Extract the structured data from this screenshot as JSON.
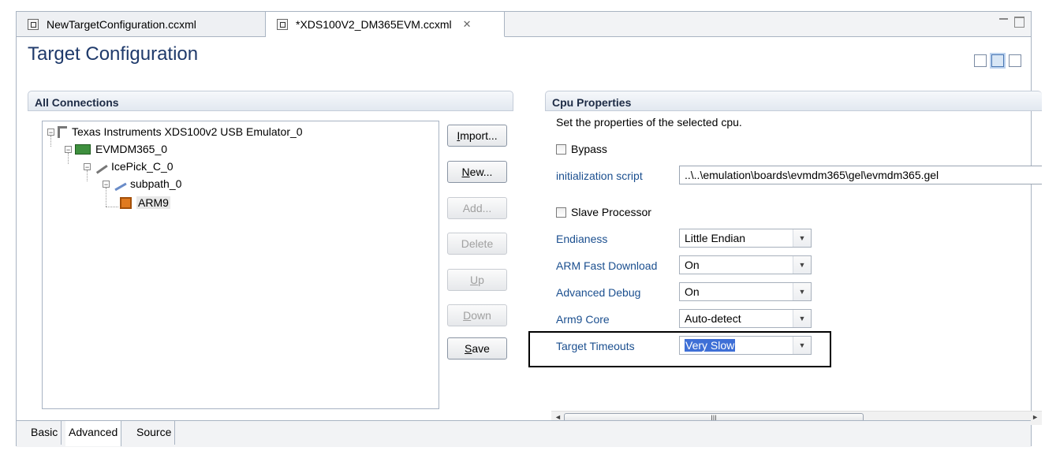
{
  "editor_tabs": [
    {
      "label": "NewTargetConfiguration.ccxml"
    },
    {
      "label": "*XDS100V2_DM365EVM.ccxml",
      "close": "✕"
    }
  ],
  "form_title": "Target Configuration",
  "connections": {
    "title": "All Connections",
    "tree": [
      {
        "label": "Texas Instruments XDS100v2 USB Emulator_0",
        "toggle": "−",
        "icon": "emulator-icon"
      },
      {
        "label": "EVMDM365_0",
        "toggle": "−",
        "icon": "board-icon"
      },
      {
        "label": "IcePick_C_0",
        "toggle": "−",
        "icon": "icepick-icon"
      },
      {
        "label": "subpath_0",
        "toggle": "−",
        "icon": "subpath-icon"
      },
      {
        "label": "ARM9",
        "icon": "cpu-icon"
      }
    ],
    "buttons": {
      "import": {
        "mn": "I",
        "rest": "mport..."
      },
      "new": {
        "mn": "N",
        "rest": "ew..."
      },
      "add": "Add...",
      "delete": "Delete",
      "up": {
        "mn": "U",
        "rest": "p"
      },
      "down": {
        "mn": "D",
        "rest": "own"
      },
      "save": {
        "mn": "S",
        "rest": "ave"
      }
    }
  },
  "cpu_properties": {
    "title": "Cpu Properties",
    "description": "Set the properties of the selected cpu.",
    "bypass_label": "Bypass",
    "init_script_label": "initialization script",
    "init_script_value": "..\\..\\emulation\\boards\\evmdm365\\gel\\evmdm365.gel",
    "slave_label": "Slave Processor",
    "endianess": {
      "label": "Endianess",
      "value": "Little Endian"
    },
    "arm_fast_download": {
      "label": "ARM Fast Download",
      "value": "On"
    },
    "advanced_debug": {
      "label": "Advanced Debug",
      "value": "On"
    },
    "arm9_core": {
      "label": "Arm9 Core",
      "value": "Auto-detect"
    },
    "target_timeouts": {
      "label": "Target Timeouts",
      "value": "Very Slow"
    }
  },
  "scrollbar": {
    "grip": "III",
    "left": "◄",
    "right": "►"
  },
  "combo_arrow": "▼",
  "bottom_tabs": [
    "Basic",
    "Advanced",
    "Source"
  ],
  "colors": {
    "label_blue": "#1b4f8f",
    "title_blue": "#1f3a6b",
    "selection": "#3e6fd6"
  }
}
